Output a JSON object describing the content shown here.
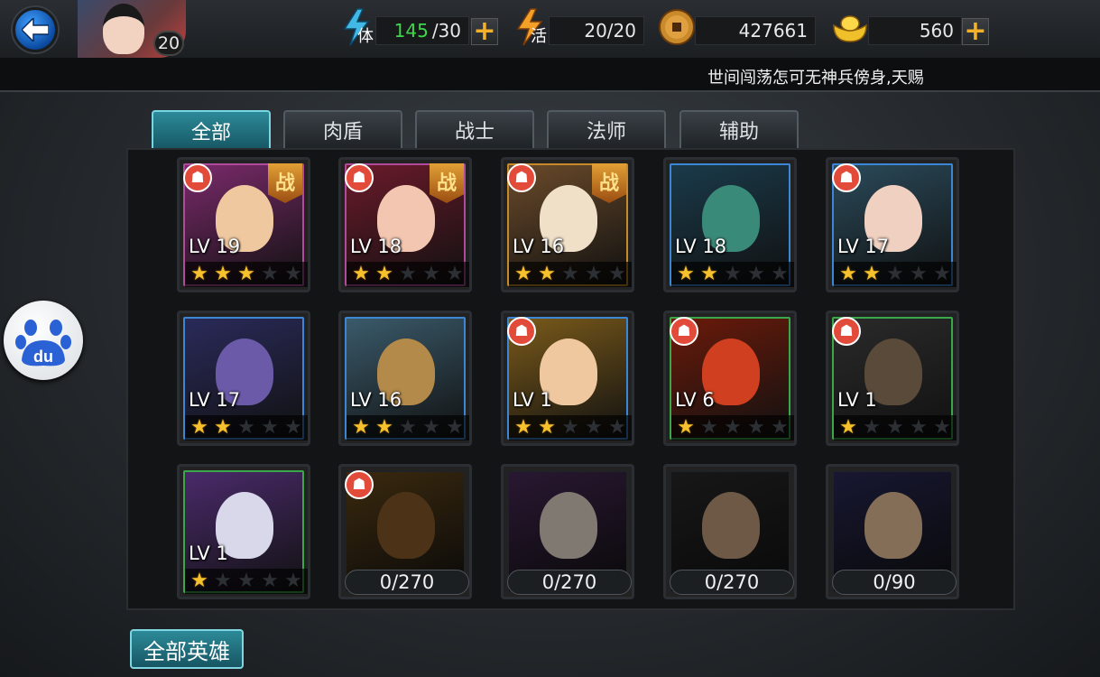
{
  "topbar": {
    "player_level": "20",
    "stamina": {
      "label": "体",
      "current": "145",
      "max": "/30"
    },
    "vitality": {
      "label": "活",
      "value": "20/20"
    },
    "coins": "427661",
    "ingots": "560",
    "plus": "+"
  },
  "marquee": {
    "text": "世间闯荡怎可无神兵傍身,天赐"
  },
  "tabs": [
    "全部",
    "肉盾",
    "战士",
    "法师",
    "辅助"
  ],
  "cards": [
    {
      "lv": "LV 19",
      "stars": 3,
      "shield": true,
      "zhan": true,
      "border": "#b04a9a",
      "bg": "#7a2a6a",
      "face": "#f0c8a0"
    },
    {
      "lv": "LV 18",
      "stars": 2,
      "shield": true,
      "zhan": true,
      "border": "#b04a9a",
      "bg": "#6a1a2a",
      "face": "#f2c6b0"
    },
    {
      "lv": "LV 16",
      "stars": 2,
      "shield": true,
      "zhan": true,
      "border": "#c78a2a",
      "bg": "#6a4a2a",
      "face": "#f0e0c8"
    },
    {
      "lv": "LV 18",
      "stars": 2,
      "shield": false,
      "zhan": false,
      "border": "#3c86d6",
      "bg": "#1a3a4a",
      "face": "#3a8a7a"
    },
    {
      "lv": "LV 17",
      "stars": 2,
      "shield": true,
      "zhan": false,
      "border": "#3c86d6",
      "bg": "#2a4a5a",
      "face": "#f0d0c0"
    },
    {
      "lv": "LV 17",
      "stars": 2,
      "shield": false,
      "zhan": false,
      "border": "#3c86d6",
      "bg": "#2a2a5a",
      "face": "#6a5aa8"
    },
    {
      "lv": "LV 16",
      "stars": 2,
      "shield": false,
      "zhan": false,
      "border": "#3c86d6",
      "bg": "#3a5a6a",
      "face": "#b48a4a"
    },
    {
      "lv": "LV 1",
      "stars": 2,
      "shield": true,
      "zhan": false,
      "border": "#3c86d6",
      "bg": "#7a5a1a",
      "face": "#f0c8a0"
    },
    {
      "lv": "LV 6",
      "stars": 1,
      "shield": true,
      "zhan": false,
      "border": "#3aa84a",
      "bg": "#6a1a0a",
      "face": "#d04020"
    },
    {
      "lv": "LV 1",
      "stars": 1,
      "shield": true,
      "zhan": false,
      "border": "#3aa84a",
      "bg": "#2a2a2a",
      "face": "#5a4a3a"
    },
    {
      "lv": "LV 1",
      "stars": 1,
      "shield": false,
      "zhan": false,
      "border": "#3aa84a",
      "bg": "#4a2a6a",
      "face": "#d8d8ea"
    }
  ],
  "fragments": [
    {
      "progress": "0/270",
      "shield": true,
      "bg": "#6a4a1a",
      "face": "#8a5a2a"
    },
    {
      "progress": "0/270",
      "shield": false,
      "bg": "#4a2a5a",
      "face": "#e8dcd0"
    },
    {
      "progress": "0/270",
      "shield": false,
      "bg": "#2a2a2a",
      "face": "#c8a080"
    },
    {
      "progress": "0/90",
      "shield": false,
      "bg": "#2a2a5a",
      "face": "#f0c8a0"
    }
  ],
  "shield_glyph": "☗",
  "zhan_label": "战",
  "all_heroes_label": "全部英雄",
  "colors": {
    "accent": "#2c8a98",
    "star": "#f6c12c",
    "green_text": "#3fd84a"
  }
}
